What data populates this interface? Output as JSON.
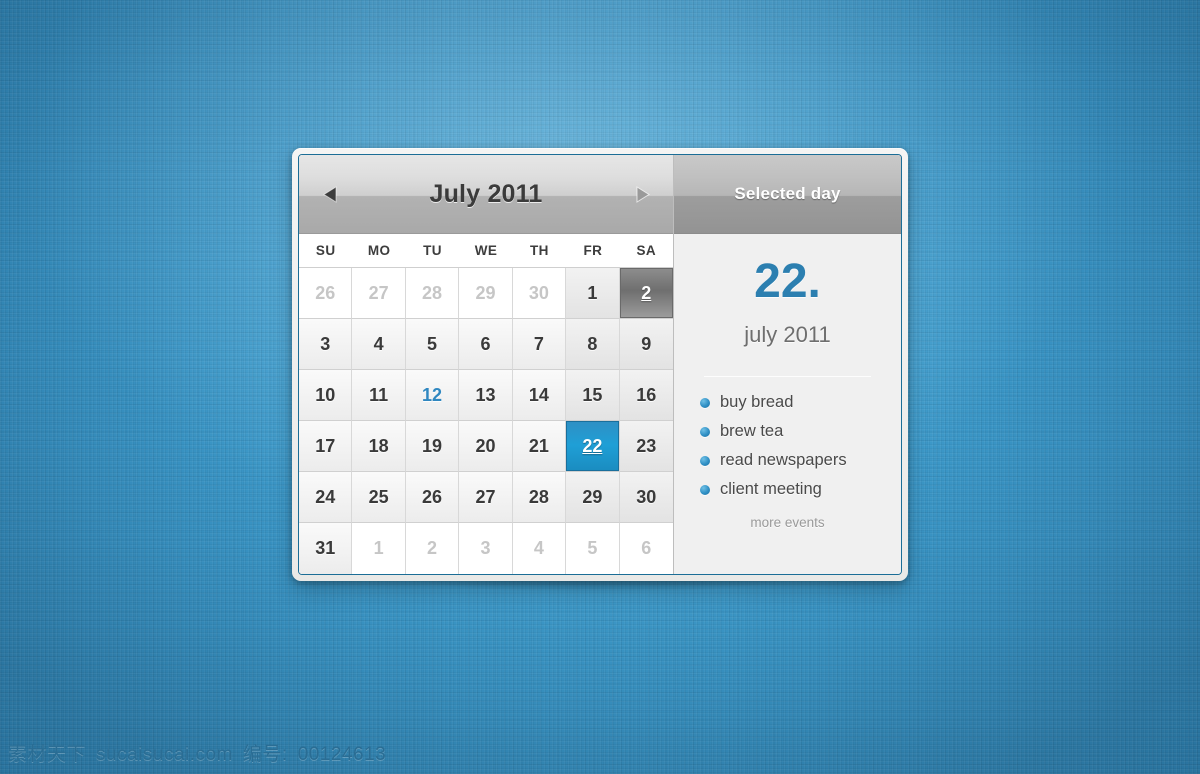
{
  "background": {
    "color": "#3193c9",
    "accent_blue": "#2c7fb0"
  },
  "calendar": {
    "header": {
      "prev_label": "◀",
      "next_label": "▶",
      "month_title": "July 2011"
    },
    "weekdays": [
      "SU",
      "MO",
      "TU",
      "WE",
      "TH",
      "FR",
      "SA"
    ],
    "days": [
      {
        "num": "26",
        "state": "other-month"
      },
      {
        "num": "27",
        "state": "other-month"
      },
      {
        "num": "28",
        "state": "other-month"
      },
      {
        "num": "29",
        "state": "other-month"
      },
      {
        "num": "30",
        "state": "other-month"
      },
      {
        "num": "1",
        "state": "weekend"
      },
      {
        "num": "2",
        "state": "hovered"
      },
      {
        "num": "3",
        "state": "normal"
      },
      {
        "num": "4",
        "state": "normal"
      },
      {
        "num": "5",
        "state": "normal"
      },
      {
        "num": "6",
        "state": "normal"
      },
      {
        "num": "7",
        "state": "normal"
      },
      {
        "num": "8",
        "state": "weekend"
      },
      {
        "num": "9",
        "state": "weekend"
      },
      {
        "num": "10",
        "state": "normal"
      },
      {
        "num": "11",
        "state": "normal"
      },
      {
        "num": "12",
        "state": "today"
      },
      {
        "num": "13",
        "state": "normal"
      },
      {
        "num": "14",
        "state": "normal"
      },
      {
        "num": "15",
        "state": "weekend"
      },
      {
        "num": "16",
        "state": "weekend"
      },
      {
        "num": "17",
        "state": "normal"
      },
      {
        "num": "18",
        "state": "normal"
      },
      {
        "num": "19",
        "state": "normal"
      },
      {
        "num": "20",
        "state": "normal"
      },
      {
        "num": "21",
        "state": "normal"
      },
      {
        "num": "22",
        "state": "selected"
      },
      {
        "num": "23",
        "state": "weekend"
      },
      {
        "num": "24",
        "state": "normal"
      },
      {
        "num": "25",
        "state": "normal"
      },
      {
        "num": "26",
        "state": "normal"
      },
      {
        "num": "27",
        "state": "normal"
      },
      {
        "num": "28",
        "state": "normal"
      },
      {
        "num": "29",
        "state": "weekend"
      },
      {
        "num": "30",
        "state": "weekend"
      },
      {
        "num": "31",
        "state": "normal"
      },
      {
        "num": "1",
        "state": "other-month"
      },
      {
        "num": "2",
        "state": "other-month"
      },
      {
        "num": "3",
        "state": "other-month"
      },
      {
        "num": "4",
        "state": "other-month"
      },
      {
        "num": "5",
        "state": "other-month"
      },
      {
        "num": "6",
        "state": "other-month"
      }
    ]
  },
  "selected_day": {
    "header_title": "Selected day",
    "date_number": "22.",
    "date_label": "july 2011",
    "events": [
      {
        "label": "buy bread"
      },
      {
        "label": "brew tea"
      },
      {
        "label": "read newspapers"
      },
      {
        "label": "client meeting"
      }
    ],
    "more_events_label": "more events"
  },
  "watermark": {
    "site_cn": "素材天下",
    "site_url": "sucaisucai.com",
    "id_label": "编号:",
    "id_value": "00124613"
  }
}
